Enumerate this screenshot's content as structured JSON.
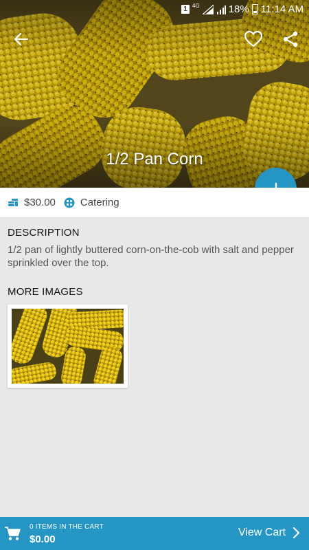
{
  "status_bar": {
    "sim": "1",
    "network": "4G",
    "battery": "18%",
    "time": "11:14 AM"
  },
  "product": {
    "title": "1/2 Pan Corn",
    "price": "$30.00",
    "category": "Catering"
  },
  "description": {
    "heading": "DESCRIPTION",
    "text": "1/2 pan of lightly buttered corn-on-the-cob with salt and pepper sprinkled over the top."
  },
  "more_images": {
    "heading": "MORE IMAGES"
  },
  "cart": {
    "count_label": "0 ITEMS IN THE CART",
    "total": "$0.00",
    "view_label": "View Cart"
  },
  "colors": {
    "accent": "#2596c4",
    "background": "#e8e8e8"
  },
  "icons": {
    "back": "arrow-left-icon",
    "favorite": "heart-outline-icon",
    "share": "share-icon",
    "add": "plus-icon",
    "price": "coins-icon",
    "category": "category-icon",
    "cart": "shopping-cart-icon",
    "view": "chevron-right-icon"
  }
}
